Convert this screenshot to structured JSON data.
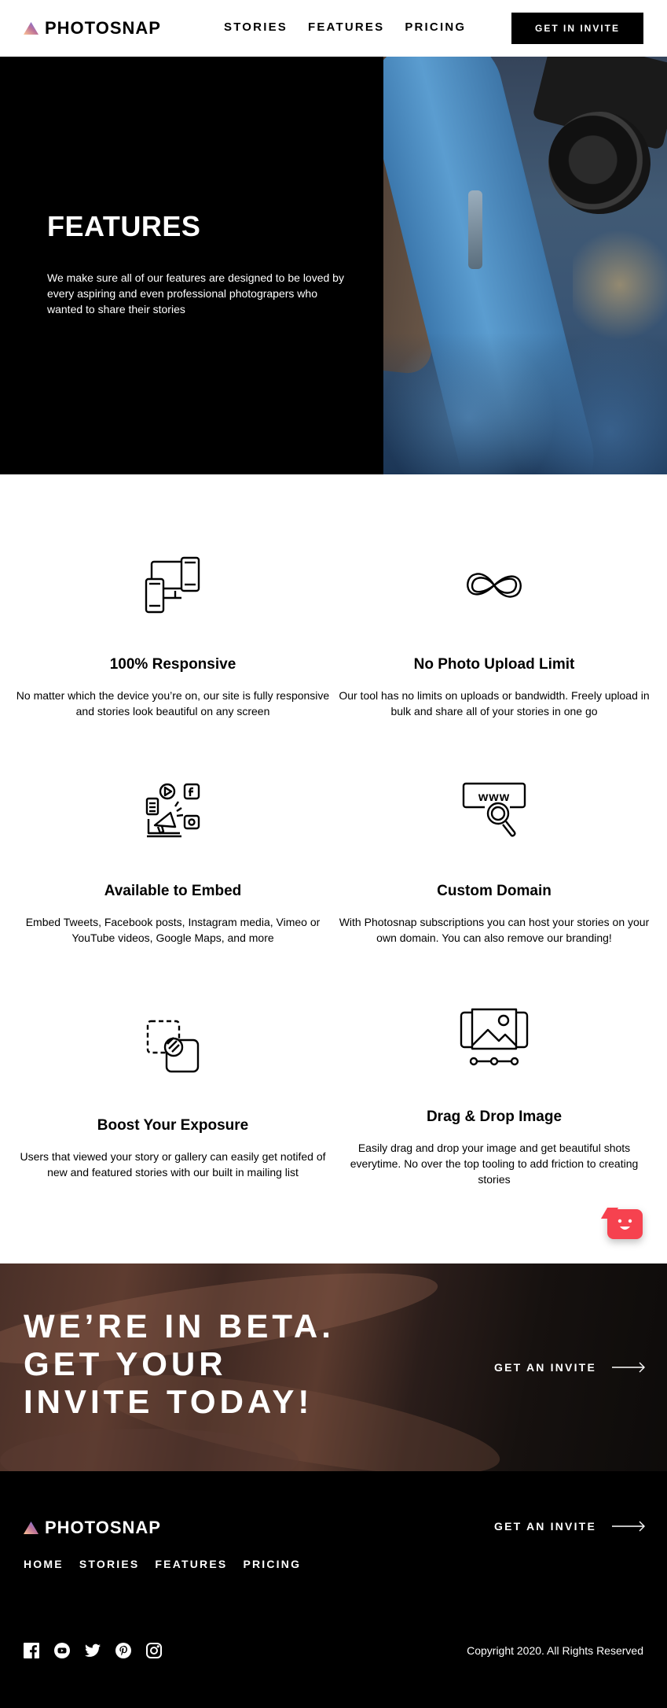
{
  "brand": {
    "name": "PHOTOSNAP",
    "gradient": [
      "#ffc593",
      "#bc7198",
      "#5a77ff"
    ]
  },
  "header": {
    "nav": [
      "STORIES",
      "FEATURES",
      "PRICING"
    ],
    "cta": "GET IN INVITE"
  },
  "hero": {
    "title": "FEATURES",
    "text": "We make sure all of our features are designed to be loved by every aspiring and even professional photograpers who wanted to share their stories",
    "image": "person holding camera"
  },
  "features": [
    {
      "icon": "devices-icon",
      "title": "100% Responsive",
      "text": "No matter which the device you’re on, our site is fully responsive and stories look beautiful on any screen"
    },
    {
      "icon": "infinity-icon",
      "title": "No Photo Upload Limit",
      "text": "Our tool has no limits on uploads or bandwidth. Freely upload in bulk and share all of your stories in one go"
    },
    {
      "icon": "embed-icon",
      "title": "Available to Embed",
      "text": "Embed Tweets, Facebook posts, Instagram media, Vimeo or YouTube videos, Google Maps, and more"
    },
    {
      "icon": "domain-icon",
      "title": "Custom Domain",
      "text": "With Photosnap subscriptions you can host your stories on your own domain. You can also remove our branding!"
    },
    {
      "icon": "exposure-icon",
      "title": "Boost Your Exposure",
      "text": "Users that viewed your story or gallery can easily get notifed of new and featured stories with our built in mailing list"
    },
    {
      "icon": "drag-drop-icon",
      "title": "Drag & Drop Image",
      "text": "Easily drag and drop your image and get beautiful shots everytime. No over the top tooling to add friction to creating stories"
    }
  ],
  "chat": {
    "icon": "chat-face-icon",
    "color": "#f6424f"
  },
  "beta": {
    "title": "WE’RE IN BETA. GET YOUR INVITE TODAY!",
    "link": "GET AN INVITE"
  },
  "footer": {
    "nav": [
      "HOME",
      "STORIES",
      "FEATURES",
      "PRICING"
    ],
    "link": "GET AN INVITE",
    "socials": [
      "facebook-icon",
      "youtube-icon",
      "twitter-icon",
      "pinterest-icon",
      "instagram-icon"
    ],
    "copyright": "Copyright 2020. All Rights Reserved"
  }
}
